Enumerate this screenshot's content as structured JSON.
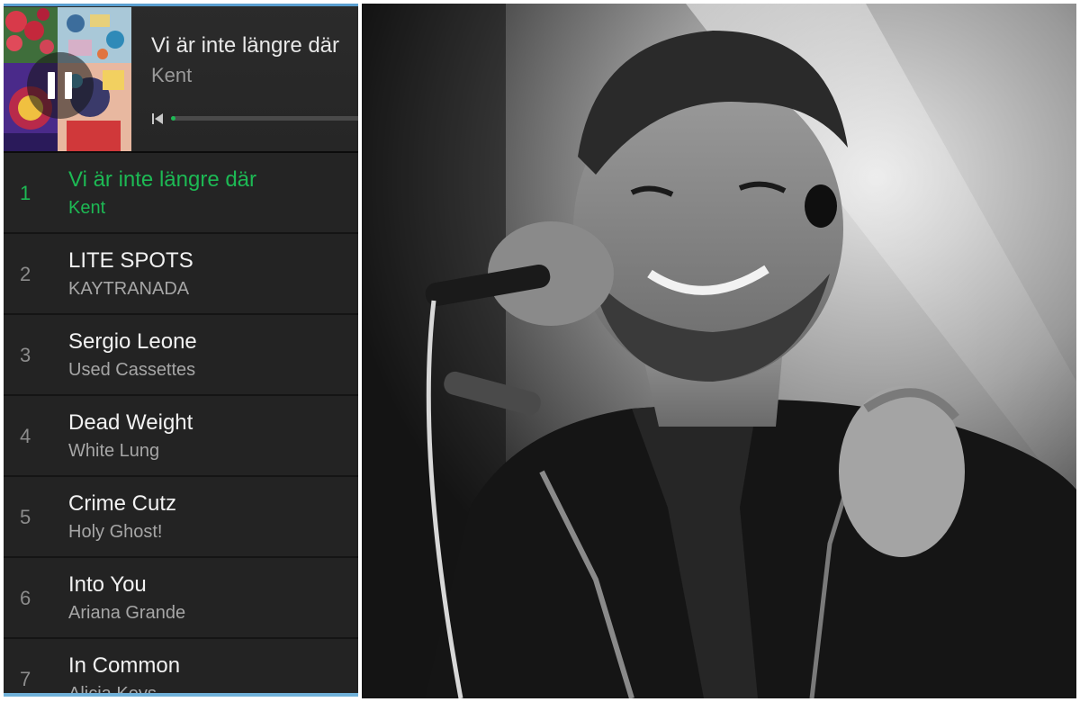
{
  "player": {
    "now_playing": {
      "title": "Vi är inte längre där",
      "artist": "Kent",
      "progress": 0.02,
      "accent_color": "#1db954",
      "controls": {
        "pause_icon": "pause-icon",
        "previous_icon": "skip-previous-icon"
      }
    },
    "tracks": [
      {
        "number": "1",
        "title": "Vi är inte längre där",
        "artist": "Kent",
        "active": true
      },
      {
        "number": "2",
        "title": "LITE SPOTS",
        "artist": "KAYTRANADA"
      },
      {
        "number": "3",
        "title": "Sergio Leone",
        "artist": "Used Cassettes"
      },
      {
        "number": "4",
        "title": "Dead Weight",
        "artist": "White Lung"
      },
      {
        "number": "5",
        "title": "Crime Cutz",
        "artist": "Holy Ghost!"
      },
      {
        "number": "6",
        "title": "Into You",
        "artist": "Ariana Grande"
      },
      {
        "number": "7",
        "title": "In Common",
        "artist": "Alicia Keys"
      }
    ]
  },
  "photo": {
    "style": "black-and-white"
  }
}
